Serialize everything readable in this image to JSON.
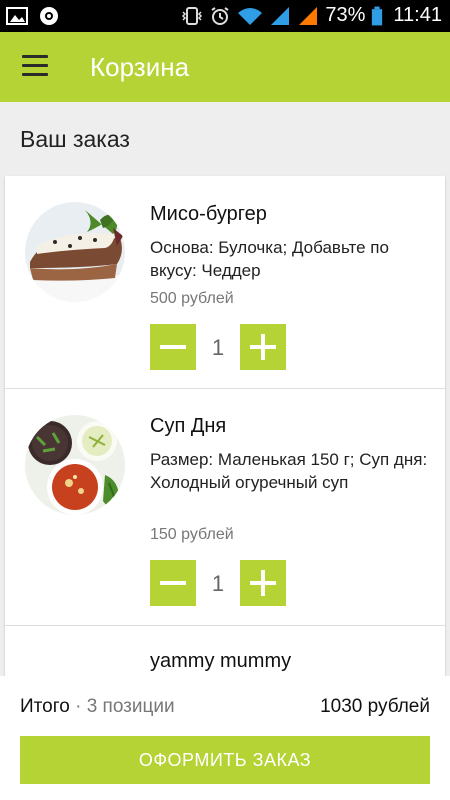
{
  "status_bar": {
    "battery_percent": "73%",
    "time": "11:41",
    "icons": [
      "image-icon",
      "browser-icon",
      "vibrate-icon",
      "alarm-icon",
      "wifi-icon",
      "signal-icon",
      "signal-icon",
      "battery-icon"
    ]
  },
  "app_bar": {
    "title": "Корзина",
    "menu_icon": "hamburger-menu-icon"
  },
  "section": {
    "title": "Ваш заказ"
  },
  "items": [
    {
      "name": "Мисо-бургер",
      "description": "Основа: Булочка; Добавьте по вкусу: Чеддер",
      "price": "500 рублей",
      "quantity": "1",
      "image": "burger-photo"
    },
    {
      "name": "Суп Дня",
      "description": "Размер: Маленькая 150 г; Суп дня: Холодный огуречный суп",
      "price": "150 рублей",
      "quantity": "1",
      "image": "soup-photo"
    },
    {
      "name": "yammy mummy"
    }
  ],
  "summary": {
    "total_label": "Итого",
    "separator": " · ",
    "count": "3 позиции",
    "total_price": "1030 рублей"
  },
  "checkout": {
    "label": "ОФОРМИТЬ ЗАКАЗ"
  },
  "colors": {
    "accent": "#b5d334",
    "status_bar_bg": "#000000",
    "wifi_signal_blue": "#2f9ee5",
    "signal_orange": "#ff7a00"
  }
}
